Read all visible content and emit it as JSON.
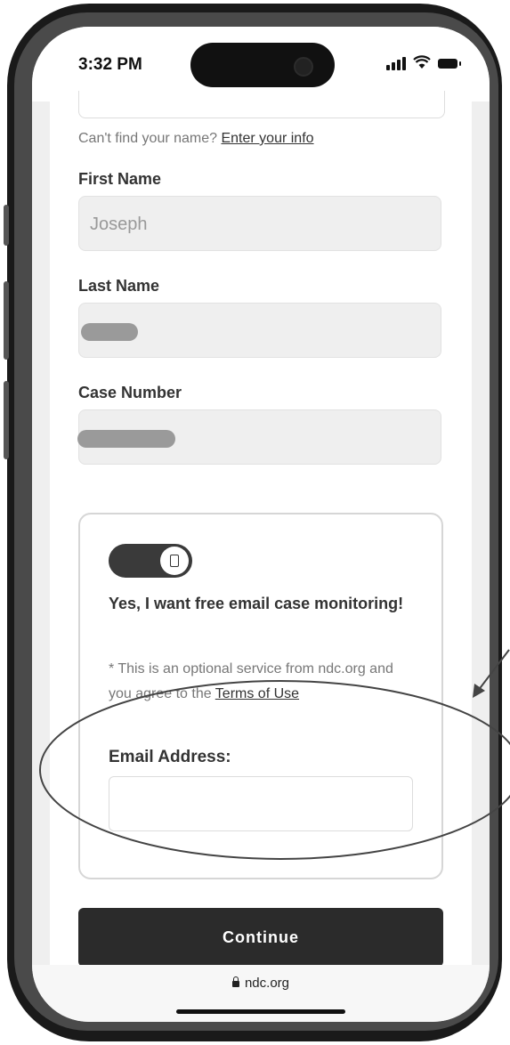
{
  "status_bar": {
    "time": "3:32 PM"
  },
  "form": {
    "cant_find_text": "Can't find your name?",
    "enter_info_link": "Enter your info",
    "first_name_label": "First Name",
    "first_name_value": "Joseph",
    "last_name_label": "Last Name",
    "case_number_label": "Case Number"
  },
  "monitoring_card": {
    "toggle_on": true,
    "optin_heading": "Yes, I want free email case monitoring!",
    "note_text": "* This is an optional service from ndc.org and you agree to the",
    "terms_link": "Terms of Use",
    "email_label": "Email Address:",
    "email_value": ""
  },
  "continue_label": "Continue",
  "browser": {
    "url": "ndc.org"
  },
  "colors": {
    "button": "#2b2b2b",
    "field_bg": "#efefef",
    "annotation": "#444444"
  },
  "icons": [
    "lock-icon",
    "signal-icon",
    "wifi-icon",
    "battery-icon"
  ]
}
